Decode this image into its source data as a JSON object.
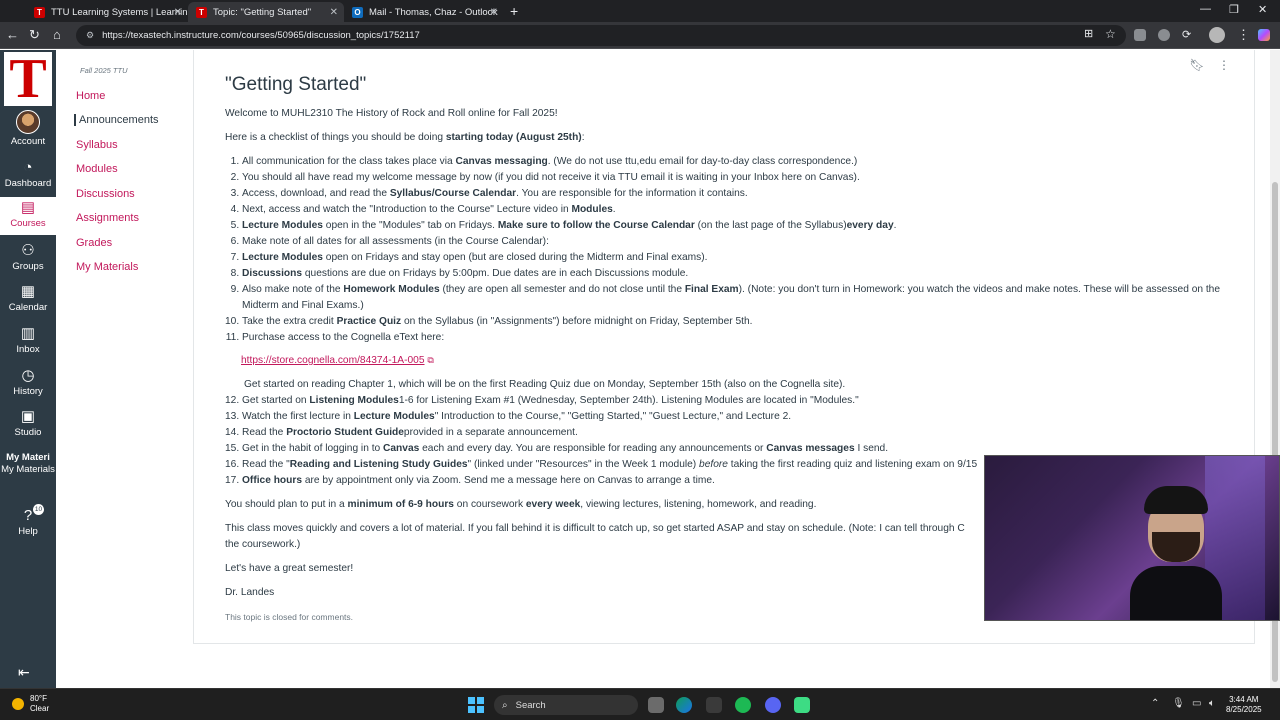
{
  "browser": {
    "tabs": [
      {
        "label": "TTU Learning Systems | Learning",
        "favicon": "T",
        "favicon_color": "#cc0000",
        "active": false
      },
      {
        "label": "Topic: \"Getting Started\"",
        "favicon": "T",
        "favicon_color": "#cc0000",
        "active": true
      },
      {
        "label": "Mail - Thomas, Chaz - Outlook",
        "favicon": "O",
        "favicon_color": "#0f6cbd",
        "active": false
      }
    ],
    "new_tab_icon": "+",
    "url": "https://texastech.instructure.com/courses/50965/discussion_topics/1752117"
  },
  "global_nav": {
    "items": [
      {
        "name": "account",
        "label": "Account",
        "icon": "avatar"
      },
      {
        "name": "dashboard",
        "label": "Dashboard",
        "icon": "gauge-icon"
      },
      {
        "name": "courses",
        "label": "Courses",
        "icon": "book-icon",
        "active": true
      },
      {
        "name": "groups",
        "label": "Groups",
        "icon": "people-icon"
      },
      {
        "name": "calendar",
        "label": "Calendar",
        "icon": "calendar-icon"
      },
      {
        "name": "inbox",
        "label": "Inbox",
        "icon": "inbox-icon"
      },
      {
        "name": "history",
        "label": "History",
        "icon": "clock-icon"
      },
      {
        "name": "studio",
        "label": "Studio",
        "icon": "studio-icon"
      },
      {
        "name": "my-materials",
        "label": "My Materials",
        "icon_text": "My Materi"
      },
      {
        "name": "help",
        "label": "Help",
        "icon": "question-icon",
        "badge": "10"
      }
    ],
    "accent_color": "#c2185b",
    "bg_color": "#2d3b45"
  },
  "course_nav": {
    "term": "Fall 2025 TTU",
    "items": [
      "Home",
      "Announcements",
      "Syllabus",
      "Modules",
      "Discussions",
      "Assignments",
      "Grades",
      "My Materials"
    ],
    "current": "Announcements"
  },
  "topic": {
    "title": "\"Getting Started\"",
    "welcome": "Welcome to MUHL2310 The History of Rock and Roll online for Fall 2025!",
    "checklist_intro": {
      "pre": "Here is a checklist of things you should be doing ",
      "bold": "starting today (August 25th)",
      "post": ":"
    },
    "items": [
      {
        "num": "1",
        "parts": [
          {
            "t": "All communication for the class takes place via "
          },
          {
            "t": "Canvas messaging",
            "b": true
          },
          {
            "t": ". (We do not use ttu,edu email for day-to-day class correspondence.)"
          }
        ]
      },
      {
        "num": "2",
        "parts": [
          {
            "t": "You should all have read my welcome message by now (if you did not receive it via TTU email it is waiting in your Inbox here on Canvas)."
          }
        ]
      },
      {
        "num": "3",
        "parts": [
          {
            "t": "Access, download, and read the "
          },
          {
            "t": "Syllabus/Course Calendar",
            "b": true
          },
          {
            "t": ". You are responsible for the information it contains."
          }
        ]
      },
      {
        "num": "4",
        "parts": [
          {
            "t": "Next, access and watch the \"Introduction to the Course\" Lecture video in "
          },
          {
            "t": "Modules",
            "b": true
          },
          {
            "t": "."
          }
        ]
      },
      {
        "num": "5",
        "parts": [
          {
            "t": "Lecture Modules",
            "b": true
          },
          {
            "t": " open in the \"Modules\" tab on Fridays. "
          },
          {
            "t": "Make sure to follow the Course Calendar",
            "b": true
          },
          {
            "t": " (on the last page of the Syllabus)"
          },
          {
            "t": "every day",
            "b": true
          },
          {
            "t": "."
          }
        ]
      },
      {
        "num": "6",
        "parts": [
          {
            "t": "Make note of all dates for all assessments (in the Course Calendar):"
          }
        ]
      },
      {
        "num": "7",
        "parts": [
          {
            "t": "Lecture Modules",
            "b": true
          },
          {
            "t": " open on Fridays and stay open (but are closed during the Midterm and Final exams)."
          }
        ]
      },
      {
        "num": "8",
        "parts": [
          {
            "t": "Discussions",
            "b": true
          },
          {
            "t": " questions are due on Fridays by 5:00pm. Due dates are in each Discussions module."
          }
        ]
      },
      {
        "num": "9",
        "parts": [
          {
            "t": "Also make note of the "
          },
          {
            "t": "Homework Modules",
            "b": true
          },
          {
            "t": " (they are open all semester and do not close until the "
          },
          {
            "t": "Final Exam",
            "b": true
          },
          {
            "t": "). (Note: you don't turn in Homework: you watch the videos and make notes. These will be assessed on the Midterm and Final Exams.)"
          }
        ]
      },
      {
        "num": "10",
        "parts": [
          {
            "t": "Take the extra credit "
          },
          {
            "t": "Practice Quiz",
            "b": true
          },
          {
            "t": " on the Syllabus (in \"Assignments\") before midnight on Friday, September 5th."
          }
        ]
      },
      {
        "num": "11",
        "parts": [
          {
            "t": "Purchase access to the Cognella eText here:"
          }
        ]
      }
    ],
    "cognella_link": "https://store.cognella.com/84374-1A-005",
    "chapter_note": "Get started on reading Chapter 1, which will be on the first Reading Quiz due on Monday, September 15th (also on the Cognella site).",
    "items_b": [
      {
        "num": "12",
        "parts": [
          {
            "t": "Get started on "
          },
          {
            "t": "Listening Modules",
            "b": true
          },
          {
            "t": "1-6 for Listening Exam #1 (Wednesday, September 24th). Listening Modules are located in \"Modules.\""
          }
        ]
      },
      {
        "num": "13",
        "parts": [
          {
            "t": "Watch the first lecture in "
          },
          {
            "t": "Lecture Modules",
            "b": true
          },
          {
            "t": "\" Introduction to the Course,\" \"Getting Started,\" \"Guest Lecture,\" and Lecture 2."
          }
        ]
      },
      {
        "num": "14",
        "parts": [
          {
            "t": "Read the "
          },
          {
            "t": "Proctorio Student Guide",
            "b": true
          },
          {
            "t": "provided in a separate announcement."
          }
        ]
      },
      {
        "num": "15",
        "parts": [
          {
            "t": "Get in the habit of logging in to "
          },
          {
            "t": "Canvas",
            "b": true
          },
          {
            "t": " each and every day. You are responsible for reading any announcements or "
          },
          {
            "t": "Canvas messages",
            "b": true
          },
          {
            "t": " I send."
          }
        ]
      },
      {
        "num": "16",
        "parts": [
          {
            "t": "Read the \""
          },
          {
            "t": "Reading and Listening Study Guides",
            "b": true
          },
          {
            "t": "\" (linked under \"Resources\" in the Week 1 module) "
          },
          {
            "t": "before",
            "i": true
          },
          {
            "t": " taking the first reading quiz and listening exam on 9/15"
          }
        ]
      },
      {
        "num": "17",
        "parts": [
          {
            "t": "Office hours",
            "b": true
          },
          {
            "t": " are by appointment only via Zoom. Send me a message here on Canvas to arrange a time."
          }
        ]
      }
    ],
    "plan": {
      "pre": "You should plan to put in a ",
      "bold1": "minimum of 6-9 hours",
      "mid": " on coursework ",
      "bold2": "every week",
      "post": ", viewing lectures, listening, homework, and reading."
    },
    "moves_quickly": "This class moves quickly and covers a lot of material. If you fall behind it is difficult to catch up, so get started ASAP and stay on schedule. (Note: I can tell through C",
    "moves_quickly_2": "the coursework.)",
    "great_semester": "Let's have a great semester!",
    "signature": "Dr. Landes",
    "closed_note": "This topic is closed for comments."
  },
  "taskbar": {
    "weather_temp": "80°F",
    "weather_desc": "Clear",
    "search_placeholder": "Search",
    "time": "3:44 AM",
    "date": "8/25/2025"
  }
}
